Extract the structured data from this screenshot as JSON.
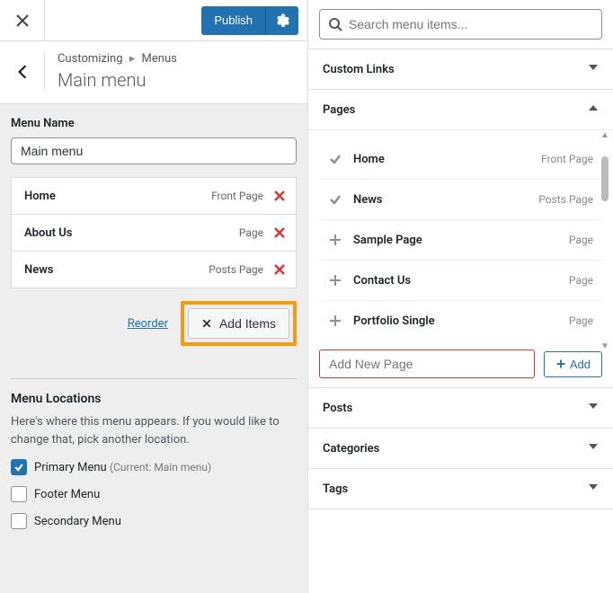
{
  "header": {
    "publish_label": "Publish",
    "breadcrumb_root": "Customizing",
    "breadcrumb_sep": "▸",
    "breadcrumb_leaf": "Menus",
    "panel_title": "Main menu"
  },
  "menu": {
    "name_label": "Menu Name",
    "name_value": "Main menu",
    "items": [
      {
        "label": "Home",
        "type": "Front Page"
      },
      {
        "label": "About Us",
        "type": "Page"
      },
      {
        "label": "News",
        "type": "Posts Page"
      }
    ],
    "reorder_label": "Reorder",
    "add_items_label": "Add Items"
  },
  "locations": {
    "heading": "Menu Locations",
    "description": "Here's where this menu appears. If you would like to change that, pick another location.",
    "items": [
      {
        "label": "Primary Menu",
        "checked": true,
        "current": "(Current: Main menu)"
      },
      {
        "label": "Footer Menu",
        "checked": false,
        "current": ""
      },
      {
        "label": "Secondary Menu",
        "checked": false,
        "current": ""
      }
    ]
  },
  "right": {
    "search_placeholder": "Search menu items...",
    "sections": {
      "custom_links": "Custom Links",
      "pages": "Pages",
      "posts": "Posts",
      "categories": "Categories",
      "tags": "Tags"
    },
    "pages": [
      {
        "label": "Home",
        "type": "Front Page",
        "added": true
      },
      {
        "label": "News",
        "type": "Posts Page",
        "added": true
      },
      {
        "label": "Sample Page",
        "type": "Page",
        "added": false
      },
      {
        "label": "Contact Us",
        "type": "Page",
        "added": false
      },
      {
        "label": "Portfolio Single",
        "type": "Page",
        "added": false
      }
    ],
    "add_new_page_placeholder": "Add New Page",
    "add_button_label": "Add"
  }
}
